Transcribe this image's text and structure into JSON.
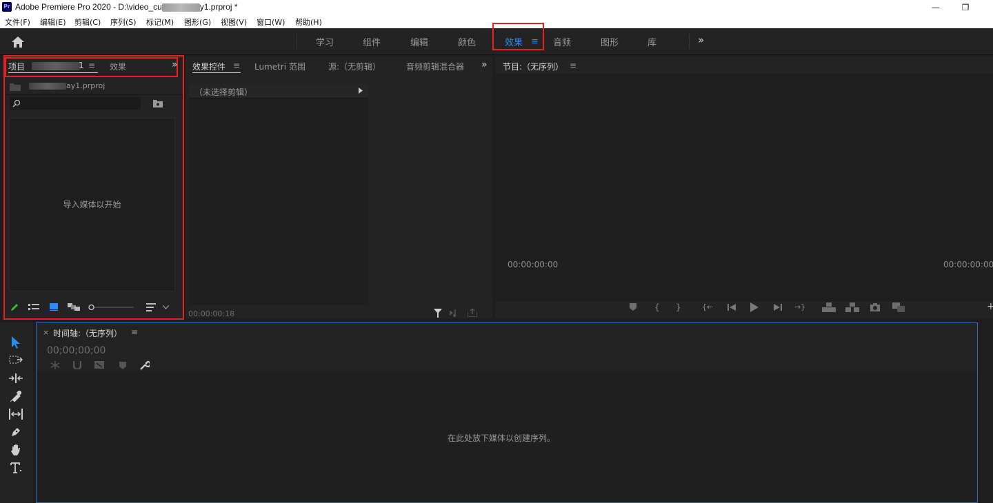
{
  "window": {
    "app_logo": "Pr",
    "title": "Adobe Premiere Pro 2020 - D:\\video_cu",
    "title_suffix": "y1.prproj *",
    "minimize": "—",
    "restore": "❐"
  },
  "menu": [
    "文件(F)",
    "编辑(E)",
    "剪辑(C)",
    "序列(S)",
    "标记(M)",
    "图形(G)",
    "视图(V)",
    "窗口(W)",
    "帮助(H)"
  ],
  "workspaces": {
    "tabs": [
      "学习",
      "组件",
      "编辑",
      "颜色",
      "效果",
      "音频",
      "图形",
      "库"
    ],
    "active": "效果",
    "menu_glyph": "≡",
    "more": "»"
  },
  "project_panel": {
    "tab_project": "项目",
    "tab_project_suffix": "1",
    "tab_effects": "效果",
    "menu_glyph": "≡",
    "more": "»",
    "file_suffix": "ay1.prproj",
    "search_placeholder": "",
    "empty_message": "导入媒体以开始"
  },
  "effects_controls": {
    "tabs": [
      "效果控件",
      "Lumetri 范围",
      "源:（无剪辑）",
      "音频剪辑混合器"
    ],
    "menu_glyph": "≡",
    "more": "»",
    "no_clip": "（未选择剪辑）",
    "timecode": "00:00:00:18"
  },
  "program_monitor": {
    "title": "节目:（无序列）",
    "menu_glyph": "≡",
    "timecode_left": "00:00:00:00",
    "timecode_right": "00:00:00:00"
  },
  "timeline": {
    "close": "×",
    "title": "时间轴:（无序列）",
    "menu_glyph": "≡",
    "timecode": "00;00;00;00",
    "empty_message": "在此处放下媒体以创建序列。"
  },
  "colors": {
    "accent": "#2d8ceb",
    "highlight_box": "#e8211f",
    "panel_bg": "#232323",
    "app_bg": "#1d1d1d"
  }
}
